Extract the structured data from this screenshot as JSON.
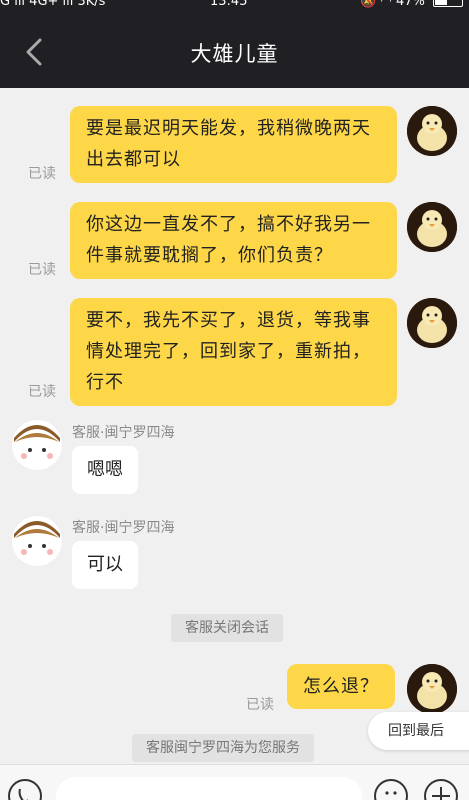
{
  "status_bar": {
    "left": "G ıll 4G+ ıll 3K/s",
    "time": "13:45",
    "battery": "47%",
    "battery_level": 0.47
  },
  "header": {
    "title": "大雄儿童"
  },
  "messages": [
    {
      "from": "me",
      "text": "要是最迟明天能发，我稍微晚两天出去都可以",
      "status": "已读"
    },
    {
      "from": "me",
      "text": "你这边一直发不了，搞不好我另一件事就要耽搁了，你们负责？",
      "status": "已读"
    },
    {
      "from": "me",
      "text": "要不，我先不买了，退货，等我事情处理完了，回到家了，重新拍，行不",
      "status": "已读"
    },
    {
      "from": "agent",
      "sender": "客服·闽宁罗四海",
      "text": "嗯嗯"
    },
    {
      "from": "agent",
      "sender": "客服·闽宁罗四海",
      "text": "可以"
    },
    {
      "from": "system",
      "text": "客服关闭会话"
    },
    {
      "from": "me",
      "text": "怎么退？",
      "status": "已读"
    },
    {
      "from": "system",
      "text": "客服闽宁罗四海为您服务"
    }
  ],
  "jump_to_latest": "回到最后",
  "colors": {
    "header_bg": "#1f1f24",
    "outgoing_bubble": "#fdd748",
    "incoming_bubble": "#ffffff",
    "chat_bg": "#f0f0f0"
  }
}
